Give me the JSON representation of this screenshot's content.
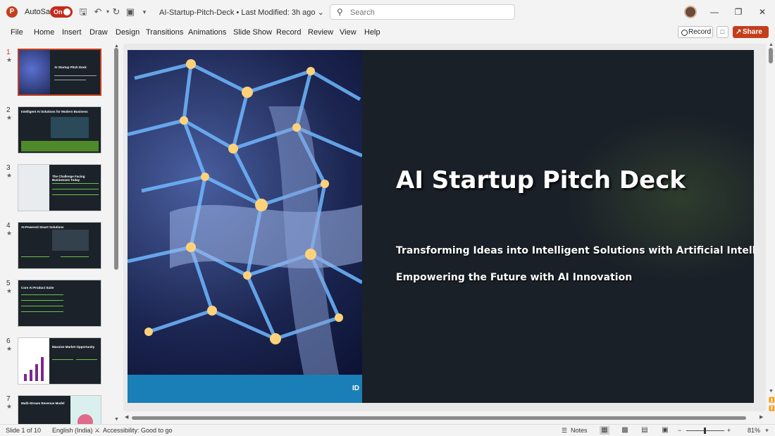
{
  "titlebar": {
    "autosave_label": "AutoSave",
    "autosave_state": "On",
    "doc_title": "AI-Startup-Pitch-Deck • Last Modified: 3h ago ⌄"
  },
  "search": {
    "placeholder": "Search"
  },
  "menu": [
    "File",
    "Home",
    "Insert",
    "Draw",
    "Design",
    "Transitions",
    "Animations",
    "Slide Show",
    "Record",
    "Review",
    "View",
    "Help"
  ],
  "ribbon_right": {
    "record_label": "Record",
    "share_label": "Share"
  },
  "thumbnails": [
    {
      "num": "1",
      "title": "AI Startup Pitch Deck"
    },
    {
      "num": "2",
      "title": "Intelligent AI Solutions for Modern Business"
    },
    {
      "num": "3",
      "title": "The Challenge Facing Businesses Today"
    },
    {
      "num": "4",
      "title": "AI-Powered Smart Solutions"
    },
    {
      "num": "5",
      "title": "Core AI Product Suite"
    },
    {
      "num": "6",
      "title": "Massive Market Opportunity"
    },
    {
      "num": "7",
      "title": "Multi-Stream Revenue Model"
    }
  ],
  "slide": {
    "title": "AI Startup Pitch Deck",
    "subtitle1": "Transforming Ideas into Intelligent Solutions with Artificial Intelligence",
    "subtitle2": "Empowering the Future with AI Innovation",
    "footer_text": "ID"
  },
  "status": {
    "slide_info": "Slide 1 of 10",
    "language": "English (India)",
    "accessibility": "Accessibility: Good to go",
    "notes": "Notes",
    "zoom": "81%"
  },
  "colors": {
    "accent": "#c43e1c",
    "slide_bg": "#1a2028",
    "slide_bar": "#1a7fb7"
  }
}
